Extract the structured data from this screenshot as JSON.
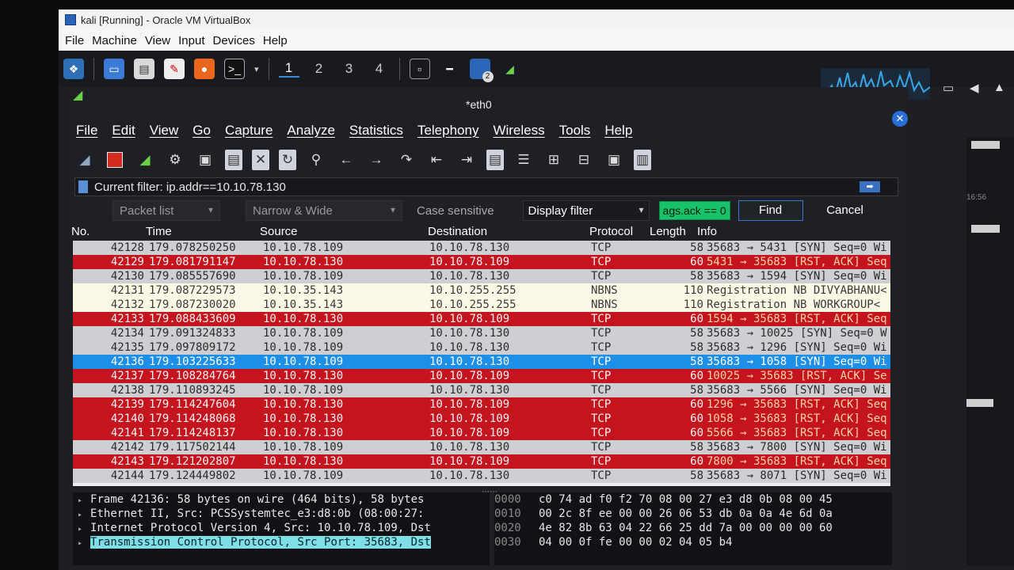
{
  "vbox": {
    "title": "kali [Running] - Oracle VM VirtualBox",
    "menu": [
      "File",
      "Machine",
      "View",
      "Input",
      "Devices",
      "Help"
    ]
  },
  "panel": {
    "workspaces": [
      "1",
      "2",
      "3",
      "4"
    ],
    "notification_badge": "2",
    "clock": "16:56"
  },
  "wireshark": {
    "tab_label": "*eth0",
    "menu": [
      "File",
      "Edit",
      "View",
      "Go",
      "Capture",
      "Analyze",
      "Statistics",
      "Telephony",
      "Wireless",
      "Tools",
      "Help"
    ],
    "filter_text": "Current filter: ip.addr==10.10.78.130",
    "find": {
      "packet_list": "Packet list",
      "narrow_wide": "Narrow & Wide",
      "case_sensitive": "Case sensitive",
      "display_filter": "Display filter",
      "query": "ags.ack == 0",
      "find_label": "Find",
      "cancel_label": "Cancel"
    },
    "columns": {
      "no": "No.",
      "time": "Time",
      "source": "Source",
      "destination": "Destination",
      "protocol": "Protocol",
      "length": "Length",
      "info": "Info"
    },
    "packets": [
      {
        "no": "42128",
        "time": "179.078250250",
        "src": "10.10.78.109",
        "dst": "10.10.78.130",
        "proto": "TCP",
        "len": "58",
        "info": "35683 → 5431 [SYN] Seq=0 Wi",
        "style": "gray"
      },
      {
        "no": "42129",
        "time": "179.081791147",
        "src": "10.10.78.130",
        "dst": "10.10.78.109",
        "proto": "TCP",
        "len": "60",
        "info": "5431 → 35683 [RST, ACK] Seq",
        "style": "red"
      },
      {
        "no": "42130",
        "time": "179.085557690",
        "src": "10.10.78.109",
        "dst": "10.10.78.130",
        "proto": "TCP",
        "len": "58",
        "info": "35683 → 1594 [SYN] Seq=0 Wi",
        "style": "gray"
      },
      {
        "no": "42131",
        "time": "179.087229573",
        "src": "10.10.35.143",
        "dst": "10.10.255.255",
        "proto": "NBNS",
        "len": "110",
        "info": "Registration NB DIVYABHANU<",
        "style": "yellow"
      },
      {
        "no": "42132",
        "time": "179.087230020",
        "src": "10.10.35.143",
        "dst": "10.10.255.255",
        "proto": "NBNS",
        "len": "110",
        "info": "Registration NB WORKGROUP<",
        "style": "yellow"
      },
      {
        "no": "42133",
        "time": "179.088433609",
        "src": "10.10.78.130",
        "dst": "10.10.78.109",
        "proto": "TCP",
        "len": "60",
        "info": "1594 → 35683 [RST, ACK] Seq",
        "style": "red"
      },
      {
        "no": "42134",
        "time": "179.091324833",
        "src": "10.10.78.109",
        "dst": "10.10.78.130",
        "proto": "TCP",
        "len": "58",
        "info": "35683 → 10025 [SYN] Seq=0 W",
        "style": "gray"
      },
      {
        "no": "42135",
        "time": "179.097809172",
        "src": "10.10.78.109",
        "dst": "10.10.78.130",
        "proto": "TCP",
        "len": "58",
        "info": "35683 → 1296 [SYN] Seq=0 Wi",
        "style": "gray"
      },
      {
        "no": "42136",
        "time": "179.103225633",
        "src": "10.10.78.109",
        "dst": "10.10.78.130",
        "proto": "TCP",
        "len": "58",
        "info": "35683 → 1058 [SYN] Seq=0 Wi",
        "style": "selected"
      },
      {
        "no": "42137",
        "time": "179.108284764",
        "src": "10.10.78.130",
        "dst": "10.10.78.109",
        "proto": "TCP",
        "len": "60",
        "info": "10025 → 35683 [RST, ACK] Se",
        "style": "red"
      },
      {
        "no": "42138",
        "time": "179.110893245",
        "src": "10.10.78.109",
        "dst": "10.10.78.130",
        "proto": "TCP",
        "len": "58",
        "info": "35683 → 5566 [SYN] Seq=0 Wi",
        "style": "gray"
      },
      {
        "no": "42139",
        "time": "179.114247604",
        "src": "10.10.78.130",
        "dst": "10.10.78.109",
        "proto": "TCP",
        "len": "60",
        "info": "1296 → 35683 [RST, ACK] Seq",
        "style": "red"
      },
      {
        "no": "42140",
        "time": "179.114248068",
        "src": "10.10.78.130",
        "dst": "10.10.78.109",
        "proto": "TCP",
        "len": "60",
        "info": "1058 → 35683 [RST, ACK] Seq",
        "style": "red"
      },
      {
        "no": "42141",
        "time": "179.114248137",
        "src": "10.10.78.130",
        "dst": "10.10.78.109",
        "proto": "TCP",
        "len": "60",
        "info": "5566 → 35683 [RST, ACK] Seq",
        "style": "red"
      },
      {
        "no": "42142",
        "time": "179.117502144",
        "src": "10.10.78.109",
        "dst": "10.10.78.130",
        "proto": "TCP",
        "len": "58",
        "info": "35683 → 7800 [SYN] Seq=0 Wi",
        "style": "gray"
      },
      {
        "no": "42143",
        "time": "179.121202807",
        "src": "10.10.78.130",
        "dst": "10.10.78.109",
        "proto": "TCP",
        "len": "60",
        "info": "7800 → 35683 [RST, ACK] Seq",
        "style": "red"
      },
      {
        "no": "42144",
        "time": "179.124449802",
        "src": "10.10.78.109",
        "dst": "10.10.78.130",
        "proto": "TCP",
        "len": "58",
        "info": "35683 → 8071 [SYN] Seq=0 Wi",
        "style": "gray"
      }
    ],
    "details": [
      "Frame 42136: 58 bytes on wire (464 bits), 58 bytes",
      "Ethernet II, Src: PCSSystemtec_e3:d8:0b (08:00:27:",
      "Internet Protocol Version 4, Src: 10.10.78.109, Dst",
      "Transmission Control Protocol, Src Port: 35683, Dst"
    ],
    "bytes": [
      {
        "offset": "0000",
        "hex": "c0 74 ad f0 f2 70 08 00  27 e3 d8 0b 08 00 45"
      },
      {
        "offset": "0010",
        "hex": "00 2c 8f ee 00 00 26 06  53 db 0a 0a 4e 6d 0a"
      },
      {
        "offset": "0020",
        "hex": "4e 82 8b 63 04 22 66 25  dd 7a 00 00 00 00 60"
      },
      {
        "offset": "0030",
        "hex": "04 00 0f fe 00 00 02 04  05 b4"
      }
    ]
  }
}
